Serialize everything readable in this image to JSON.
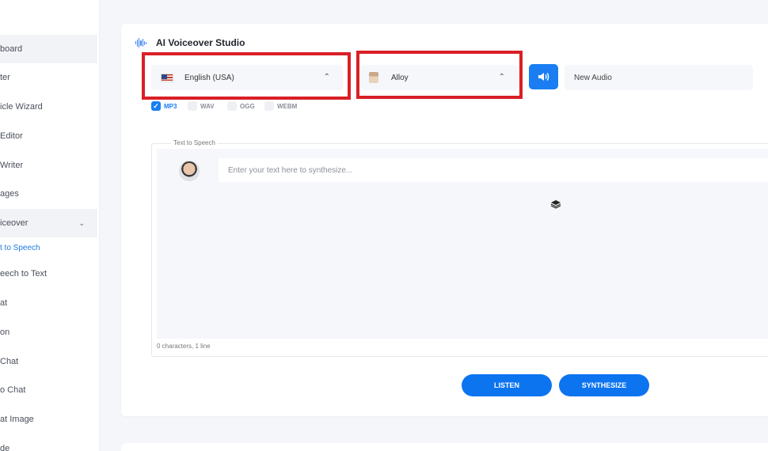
{
  "sidebar": {
    "items": [
      {
        "label": "board"
      },
      {
        "label": "ter"
      },
      {
        "label": "icle Wizard"
      },
      {
        "label": " Editor"
      },
      {
        "label": "Writer"
      },
      {
        "label": "ages"
      },
      {
        "label": "iceover"
      },
      {
        "label": "eech to Text"
      },
      {
        "label": "at"
      },
      {
        "label": "on"
      },
      {
        "label": " Chat"
      },
      {
        "label": "o Chat"
      },
      {
        "label": "at Image"
      },
      {
        "label": "de"
      }
    ],
    "sub_item": "t to Speech"
  },
  "studio": {
    "title": "AI Voiceover Studio",
    "language": "English (USA)",
    "voice": "Alloy",
    "audio_name": "New Audio",
    "formats": [
      {
        "label": "MP3",
        "checked": true
      },
      {
        "label": "WAV",
        "checked": false
      },
      {
        "label": "OGG",
        "checked": false
      },
      {
        "label": "WEBM",
        "checked": false
      }
    ],
    "tts_legend": "Text to Speech",
    "input_placeholder": "Enter your text here to synthesize...",
    "char_count": "0 characters, 1 line",
    "listen_label": "LISTEN",
    "synthesize_label": "SYNTHESIZE"
  },
  "colors": {
    "accent": "#1a7ef2",
    "highlight": "#d91f26"
  }
}
